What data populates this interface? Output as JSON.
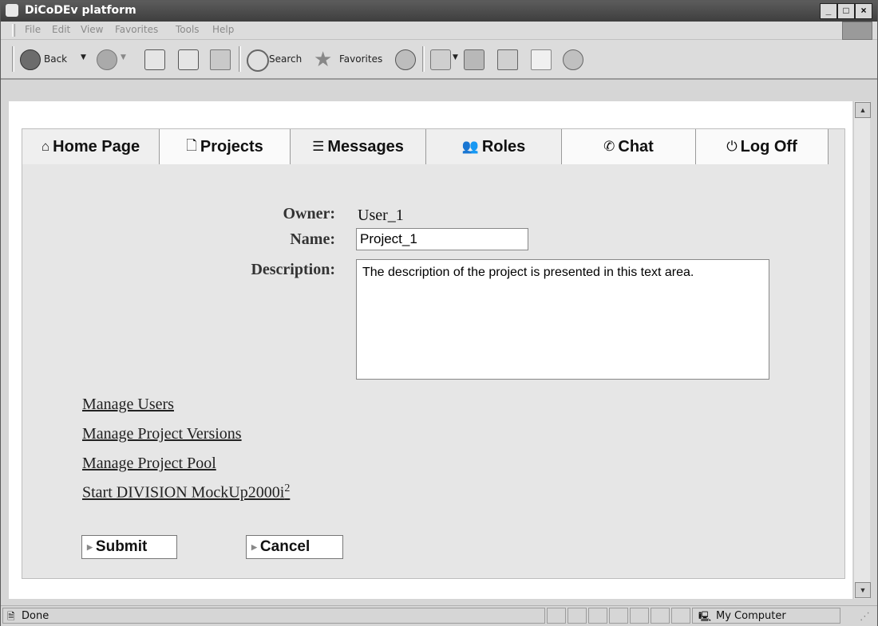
{
  "window": {
    "title": "DiCoDEv platform",
    "controls": {
      "minimize": "_",
      "maximize": "□",
      "close": "×"
    }
  },
  "menubar": {
    "items": [
      "File",
      "Edit",
      "View",
      "Favorites",
      "Tools",
      "Help"
    ]
  },
  "toolbar": {
    "back_label": "Back",
    "search_label": "Search",
    "favorites_label": "Favorites"
  },
  "tabs": [
    {
      "label": "Home Page",
      "icon": "home-icon"
    },
    {
      "label": "Projects",
      "icon": "document-icon"
    },
    {
      "label": "Messages",
      "icon": "message-icon"
    },
    {
      "label": "Roles",
      "icon": "people-icon"
    },
    {
      "label": "Chat",
      "icon": "chat-icon"
    },
    {
      "label": "Log Off",
      "icon": "power-icon"
    }
  ],
  "form": {
    "owner_label": "Owner:",
    "owner_value": "User_1",
    "name_label": "Name:",
    "name_value": "Project_1",
    "description_label": "Description:",
    "description_value": "The description of the project is presented in this text area."
  },
  "links": {
    "manage_users": "Manage Users",
    "manage_versions": "Manage Project Versions",
    "manage_pool": "Manage Project Pool",
    "start_division": "Start DIVISION MockUp2000i",
    "start_division_sup": "2"
  },
  "buttons": {
    "submit": "Submit",
    "cancel": "Cancel"
  },
  "statusbar": {
    "status": "Done",
    "zone": "My Computer"
  }
}
